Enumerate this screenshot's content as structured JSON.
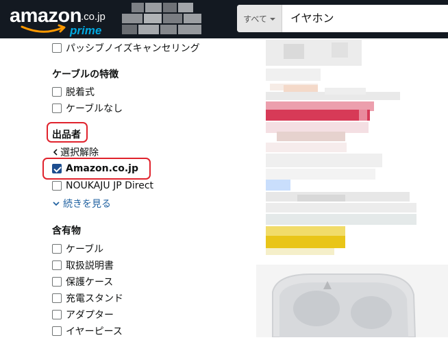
{
  "header": {
    "logo": {
      "text": "amazon",
      "tld": ".co.jp",
      "sub": "prime"
    },
    "search": {
      "department": "すべて",
      "query": "イヤホン"
    }
  },
  "sidebar": {
    "top_option": {
      "label": "パッシブノイズキャンセリング",
      "checked": false
    },
    "cable_section": {
      "heading": "ケーブルの特徴",
      "options": [
        {
          "label": "脱着式",
          "checked": false
        },
        {
          "label": "ケーブルなし",
          "checked": false
        }
      ]
    },
    "seller_section": {
      "heading": "出品者",
      "clear_link": "選択解除",
      "options": [
        {
          "label": "Amazon.co.jp",
          "checked": true
        },
        {
          "label": "NOUKAJU JP Direct",
          "checked": false
        }
      ],
      "see_more": "続きを見る"
    },
    "contents_section": {
      "heading": "含有物",
      "options": [
        {
          "label": "ケーブル",
          "checked": false
        },
        {
          "label": "取扱説明書",
          "checked": false
        },
        {
          "label": "保護ケース",
          "checked": false
        },
        {
          "label": "充電スタンド",
          "checked": false
        },
        {
          "label": "アダプター",
          "checked": false
        },
        {
          "label": "イヤーピース",
          "checked": false
        }
      ]
    }
  },
  "colors": {
    "header_bg": "#131921",
    "highlight": "#e0222c",
    "link": "#2162a1",
    "checkbox_checked": "#1d4e8f",
    "prime_blue": "#00a8e1"
  }
}
